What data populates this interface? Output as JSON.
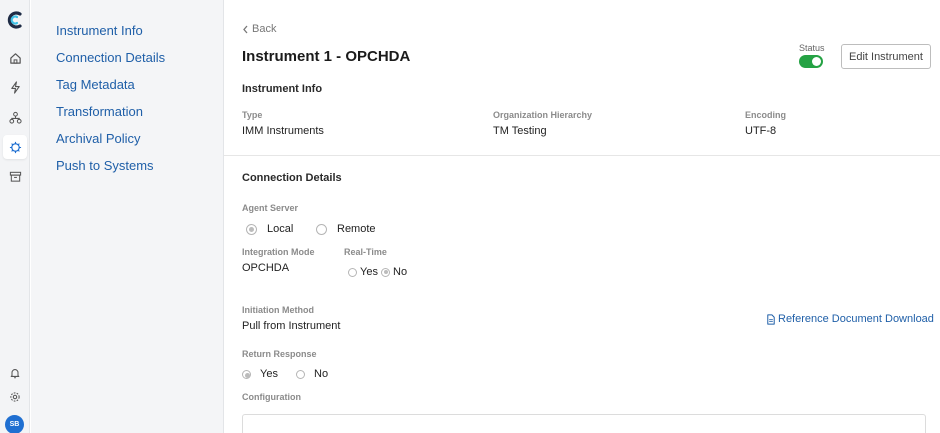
{
  "rail": {
    "items": [
      "home-icon",
      "bolt-icon",
      "hierarchy-icon",
      "instrument-icon",
      "archive-icon"
    ],
    "bottom": [
      "bell-icon",
      "gear-icon"
    ],
    "avatar": "SB",
    "accent": "#1f6fd1"
  },
  "subnav": {
    "items": [
      "Instrument Info",
      "Connection Details",
      "Tag Metadata",
      "Transformation",
      "Archival Policy",
      "Push to Systems"
    ]
  },
  "header": {
    "back": "Back",
    "title": "Instrument 1 - OPCHDA",
    "status_label": "Status",
    "status_on": true,
    "edit_button": "Edit Instrument"
  },
  "instrument_info": {
    "title": "Instrument Info",
    "type_label": "Type",
    "type_value": "IMM Instruments",
    "org_label": "Organization Hierarchy",
    "org_value": "TM Testing",
    "encoding_label": "Encoding",
    "encoding_value": "UTF-8"
  },
  "connection": {
    "title": "Connection Details",
    "agent_label": "Agent Server",
    "agent_local": "Local",
    "agent_remote": "Remote",
    "agent_selected": "Local",
    "mode_label": "Integration Mode",
    "mode_value": "OPCHDA",
    "realtime_label": "Real-Time",
    "realtime_yes": "Yes",
    "realtime_no": "No",
    "realtime_selected": "No",
    "initiation_label": "Initiation Method",
    "initiation_value": "Pull from Instrument",
    "ref_link": "Reference Document Download",
    "return_label": "Return Response",
    "return_yes": "Yes",
    "return_no": "No",
    "return_selected": "Yes",
    "config_label": "Configuration"
  },
  "colors": {
    "link": "#1f5fa8",
    "toggle_on": "#25a244"
  }
}
